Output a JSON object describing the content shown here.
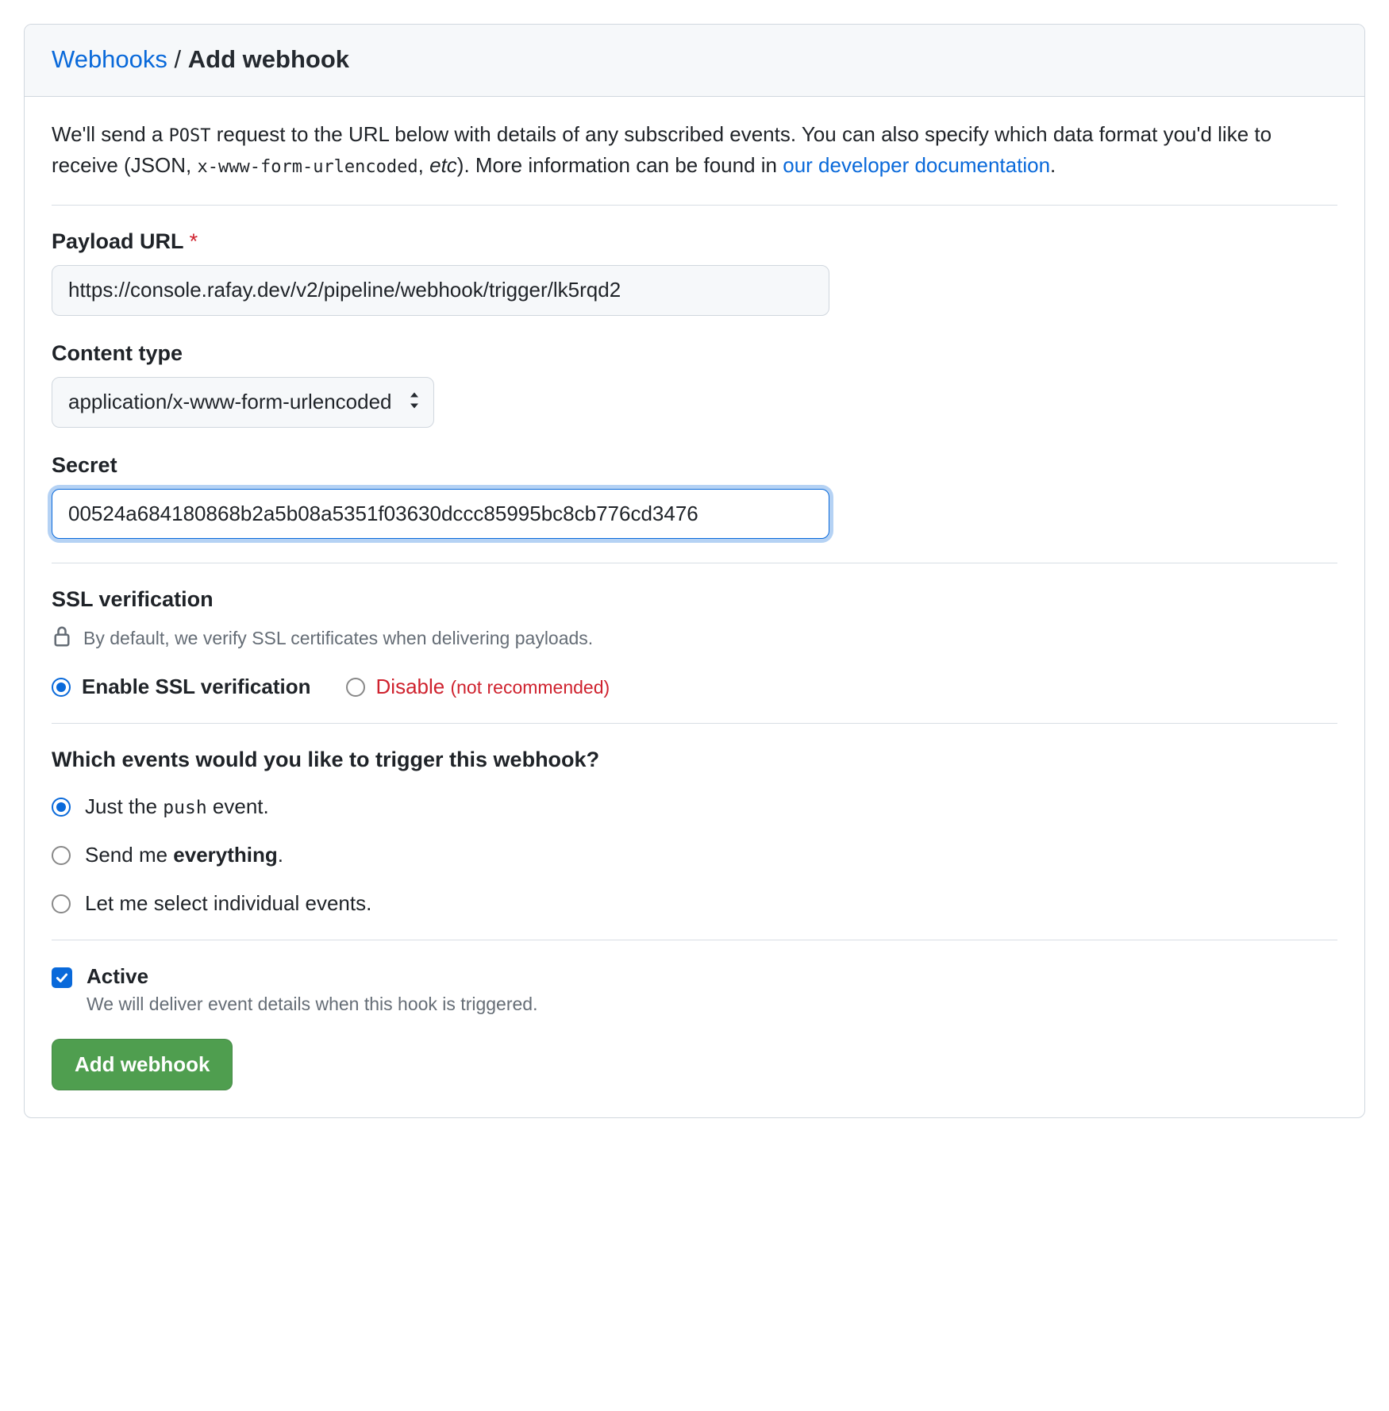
{
  "breadcrumb": {
    "parent": "Webhooks",
    "sep": "/",
    "current": "Add webhook"
  },
  "intro": {
    "pre": "We'll send a ",
    "post_code": "POST",
    "mid1": " request to the URL below with details of any subscribed events. You can also specify which data format you'd like to receive (JSON, ",
    "format_code": "x-www-form-urlencoded",
    "mid2": ", ",
    "etc": "etc",
    "mid3": "). More information can be found in ",
    "link": "our developer documentation",
    "tail": "."
  },
  "payload_url": {
    "label": "Payload URL",
    "required_mark": "*",
    "value": "https://console.rafay.dev/v2/pipeline/webhook/trigger/lk5rqd2"
  },
  "content_type": {
    "label": "Content type",
    "selected": "application/x-www-form-urlencoded"
  },
  "secret": {
    "label": "Secret",
    "value": "00524a684180868b2a5b08a5351f03630dccc85995bc8cb776cd3476"
  },
  "ssl": {
    "heading": "SSL verification",
    "note": "By default, we verify SSL certificates when delivering payloads.",
    "enable_label": "Enable SSL verification",
    "disable_label": "Disable",
    "disable_note": "(not recommended)"
  },
  "events": {
    "heading": "Which events would you like to trigger this webhook?",
    "opt_push_pre": "Just the ",
    "opt_push_code": "push",
    "opt_push_post": " event.",
    "opt_everything_pre": "Send me ",
    "opt_everything_strong": "everything",
    "opt_everything_post": ".",
    "opt_individual": "Let me select individual events."
  },
  "active": {
    "label": "Active",
    "desc": "We will deliver event details when this hook is triggered."
  },
  "submit": {
    "label": "Add webhook"
  }
}
